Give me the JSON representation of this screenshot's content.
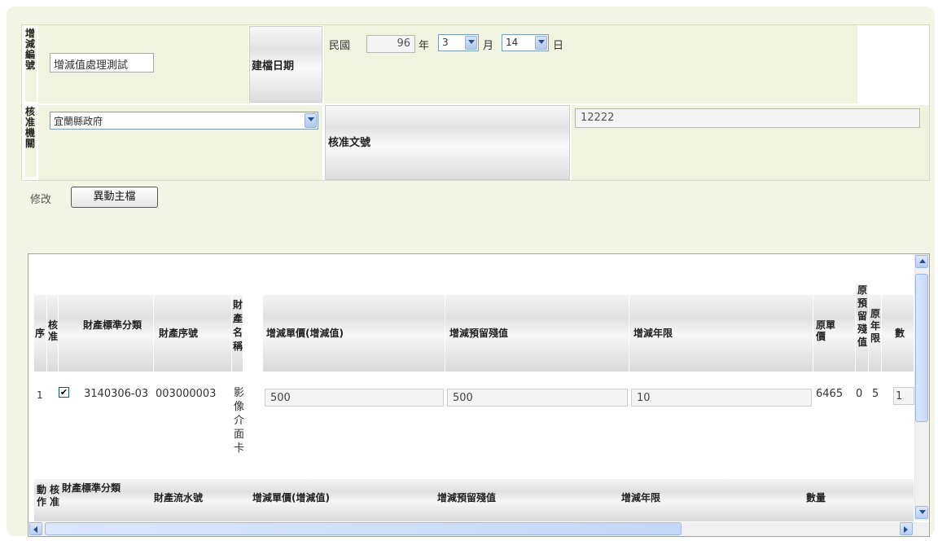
{
  "form": {
    "case_no_label": "增減編號",
    "case_no_value": "增減值處理測試",
    "build_date_label": "建檔日期",
    "era_label": "民國",
    "year_value": "96",
    "year_unit": "年",
    "month_value": "3",
    "month_unit": "月",
    "day_value": "14",
    "day_unit": "日",
    "approve_org_label": "核准機關",
    "approve_org_value": "宜蘭縣政府",
    "approve_doc_label": "核准文號",
    "approve_doc_value": "12222"
  },
  "actions": {
    "edit_label": "修改",
    "master_label": "異動主檔"
  },
  "grid": {
    "headers": {
      "seq": "序",
      "approve": "核准",
      "category": "財產標準分類",
      "serial": "財產序號",
      "name": "財產名稱",
      "unit_price": "增減單價(增減值)",
      "residual": "增減預留殘值",
      "years": "增減年限",
      "orig_price": "原單價",
      "orig_residual": "原預留殘值",
      "orig_years": "原年限",
      "qty": "數"
    },
    "row": {
      "seq": "1",
      "checked": "✔",
      "category": "3140306-03",
      "serial": "003000003",
      "name": "影像介面卡",
      "unit_price": "500",
      "residual": "500",
      "years": "10",
      "orig_price": "6465",
      "orig_residual": "0",
      "orig_years": "5",
      "qty": "1"
    },
    "footer_headers": {
      "action": "動作",
      "approve": "核准",
      "category": "財產標準分類",
      "serial": "財產流水號",
      "unit_price": "增減單價(增減值)",
      "residual": "增減預留殘值",
      "years": "增減年限",
      "qty": "數量"
    }
  }
}
